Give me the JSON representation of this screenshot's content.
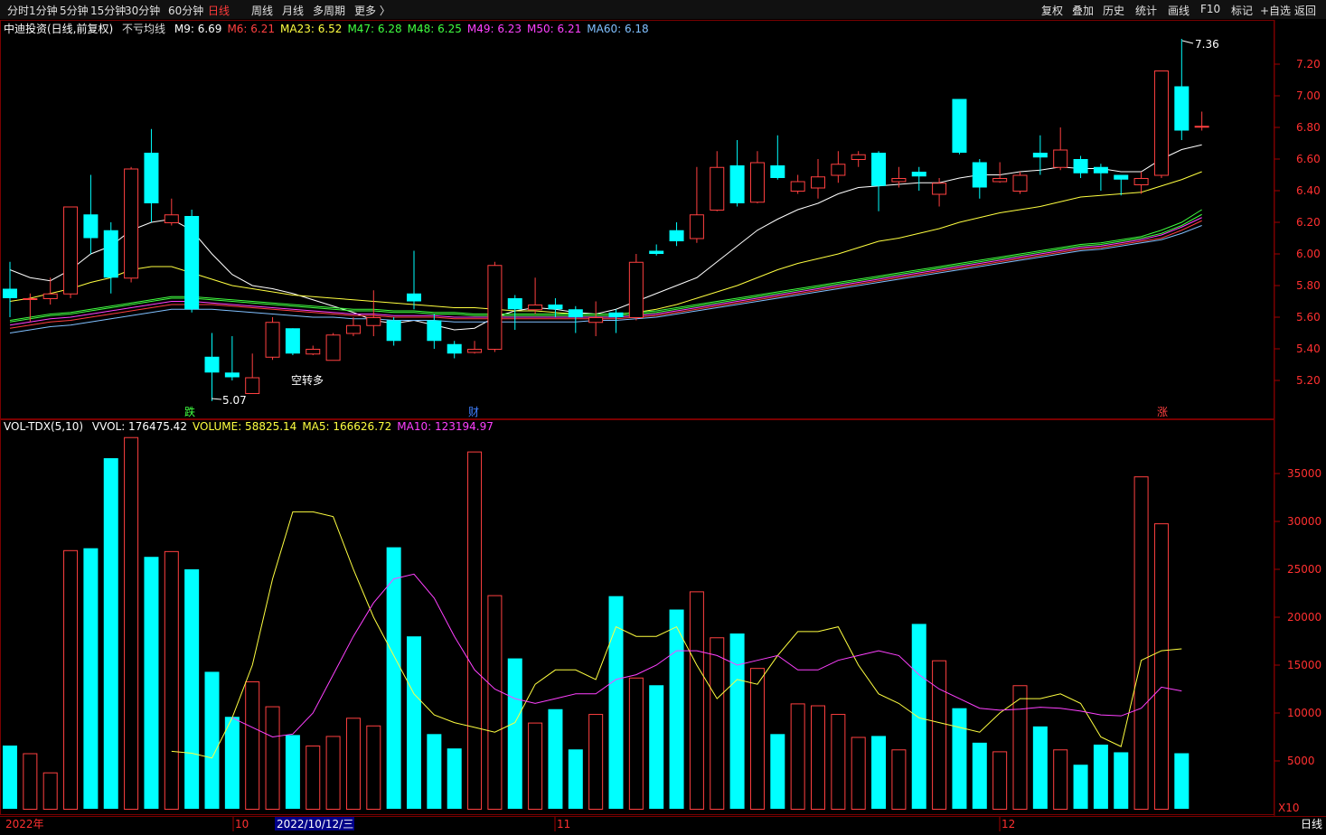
{
  "toolbar": {
    "periods": [
      "分时",
      "1分钟",
      "5分钟",
      "15分钟",
      "30分钟",
      "60分钟",
      "日线",
      "周线",
      "月线",
      "多周期",
      "更多 〉"
    ],
    "active_period": "日线",
    "right_items": [
      "复权",
      "叠加",
      "历史",
      "统计",
      "画线",
      "F10",
      "标记",
      "+自选",
      "返回"
    ]
  },
  "candle_legend": {
    "stock": "中迪投资(日线,前复权)",
    "indicator": "不亏均线",
    "items": [
      {
        "label": "M9: 6.69",
        "color": "#ffffff"
      },
      {
        "label": "M6: 6.21",
        "color": "#ff4040"
      },
      {
        "label": "MA23: 6.52",
        "color": "#ffff40"
      },
      {
        "label": "M47: 6.28",
        "color": "#40ff40"
      },
      {
        "label": "M48: 6.25",
        "color": "#40ff40"
      },
      {
        "label": "M49: 6.23",
        "color": "#ff40ff"
      },
      {
        "label": "M50: 6.21",
        "color": "#ff40ff"
      },
      {
        "label": "MA60: 6.18",
        "color": "#80c0ff"
      }
    ]
  },
  "vol_legend": {
    "name": "VOL-TDX(5,10)",
    "items": [
      {
        "label": "VVOL: 176475.42",
        "color": "#ffffff"
      },
      {
        "label": "VOLUME: 58825.14",
        "color": "#ffff40"
      },
      {
        "label": "MA5: 166626.72",
        "color": "#ffff40"
      },
      {
        "label": "MA10: 123194.97",
        "color": "#ff40ff"
      }
    ]
  },
  "price_axis": [
    "7.20",
    "7.00",
    "6.80",
    "6.60",
    "6.40",
    "6.20",
    "6.00",
    "5.80",
    "5.60",
    "5.40",
    "5.20"
  ],
  "vol_axis": [
    "35000",
    "30000",
    "25000",
    "20000",
    "15000",
    "10000",
    "5000"
  ],
  "annotations": {
    "high": "7.36",
    "low": "5.07",
    "signal": "空转多",
    "marker_down": "跌",
    "marker_fin": "财",
    "marker_up": "涨",
    "vol_unit": "X10"
  },
  "date_axis": {
    "year": "2022年",
    "months": [
      "10",
      "11",
      "12"
    ],
    "cursor_date": "2022/10/12/三"
  },
  "bottom_tab": "日线",
  "colors": {
    "up": "#ff4040",
    "down": "#00ffff",
    "bg": "#000000"
  },
  "chart_data": {
    "type": "candlestick",
    "candles": [
      {
        "o": 5.78,
        "c": 5.72,
        "h": 5.95,
        "l": 5.6
      },
      {
        "o": 5.72,
        "c": 5.72,
        "h": 5.75,
        "l": 5.57
      },
      {
        "o": 5.72,
        "c": 5.75,
        "h": 5.85,
        "l": 5.68
      },
      {
        "o": 5.75,
        "c": 6.3,
        "h": 6.3,
        "l": 5.72
      },
      {
        "o": 6.25,
        "c": 6.1,
        "h": 6.5,
        "l": 6.0
      },
      {
        "o": 6.15,
        "c": 5.85,
        "h": 6.2,
        "l": 5.75
      },
      {
        "o": 5.85,
        "c": 6.54,
        "h": 6.55,
        "l": 5.82
      },
      {
        "o": 6.64,
        "c": 6.32,
        "h": 6.79,
        "l": 6.2
      },
      {
        "o": 6.2,
        "c": 6.25,
        "h": 6.35,
        "l": 6.18
      },
      {
        "o": 6.24,
        "c": 5.65,
        "h": 6.28,
        "l": 5.63
      },
      {
        "o": 5.35,
        "c": 5.25,
        "h": 5.5,
        "l": 5.07
      },
      {
        "o": 5.25,
        "c": 5.22,
        "h": 5.48,
        "l": 5.2
      },
      {
        "o": 5.12,
        "c": 5.22,
        "h": 5.37,
        "l": 5.12
      },
      {
        "o": 5.35,
        "c": 5.57,
        "h": 5.6,
        "l": 5.33
      },
      {
        "o": 5.53,
        "c": 5.37,
        "h": 5.53,
        "l": 5.36
      },
      {
        "o": 5.37,
        "c": 5.4,
        "h": 5.42,
        "l": 5.36
      },
      {
        "o": 5.33,
        "c": 5.49,
        "h": 5.5,
        "l": 5.33
      },
      {
        "o": 5.5,
        "c": 5.55,
        "h": 5.6,
        "l": 5.48
      },
      {
        "o": 5.55,
        "c": 5.6,
        "h": 5.77,
        "l": 5.48
      },
      {
        "o": 5.58,
        "c": 5.45,
        "h": 5.6,
        "l": 5.42
      },
      {
        "o": 5.75,
        "c": 5.7,
        "h": 6.02,
        "l": 5.65
      },
      {
        "o": 5.58,
        "c": 5.45,
        "h": 5.62,
        "l": 5.4
      },
      {
        "o": 5.43,
        "c": 5.37,
        "h": 5.45,
        "l": 5.34
      },
      {
        "o": 5.38,
        "c": 5.4,
        "h": 5.45,
        "l": 5.37
      },
      {
        "o": 5.4,
        "c": 5.93,
        "h": 5.95,
        "l": 5.38
      },
      {
        "o": 5.72,
        "c": 5.65,
        "h": 5.74,
        "l": 5.52
      },
      {
        "o": 5.65,
        "c": 5.68,
        "h": 5.85,
        "l": 5.62
      },
      {
        "o": 5.68,
        "c": 5.65,
        "h": 5.72,
        "l": 5.6
      },
      {
        "o": 5.65,
        "c": 5.6,
        "h": 5.67,
        "l": 5.5
      },
      {
        "o": 5.57,
        "c": 5.6,
        "h": 5.7,
        "l": 5.48
      },
      {
        "o": 5.63,
        "c": 5.6,
        "h": 5.65,
        "l": 5.5
      },
      {
        "o": 5.6,
        "c": 5.95,
        "h": 6.0,
        "l": 5.58
      },
      {
        "o": 6.02,
        "c": 6.0,
        "h": 6.06,
        "l": 5.99
      },
      {
        "o": 6.15,
        "c": 6.08,
        "h": 6.2,
        "l": 6.05
      },
      {
        "o": 6.1,
        "c": 6.25,
        "h": 6.55,
        "l": 6.07
      },
      {
        "o": 6.28,
        "c": 6.55,
        "h": 6.65,
        "l": 6.27
      },
      {
        "o": 6.56,
        "c": 6.32,
        "h": 6.72,
        "l": 6.3
      },
      {
        "o": 6.33,
        "c": 6.58,
        "h": 6.65,
        "l": 6.32
      },
      {
        "o": 6.56,
        "c": 6.48,
        "h": 6.75,
        "l": 6.47
      },
      {
        "o": 6.4,
        "c": 6.46,
        "h": 6.5,
        "l": 6.38
      },
      {
        "o": 6.42,
        "c": 6.49,
        "h": 6.6,
        "l": 6.35
      },
      {
        "o": 6.5,
        "c": 6.57,
        "h": 6.65,
        "l": 6.45
      },
      {
        "o": 6.6,
        "c": 6.63,
        "h": 6.65,
        "l": 6.55
      },
      {
        "o": 6.64,
        "c": 6.43,
        "h": 6.65,
        "l": 6.27
      },
      {
        "o": 6.46,
        "c": 6.48,
        "h": 6.55,
        "l": 6.42
      },
      {
        "o": 6.52,
        "c": 6.49,
        "h": 6.55,
        "l": 6.4
      },
      {
        "o": 6.38,
        "c": 6.45,
        "h": 6.48,
        "l": 6.3
      },
      {
        "o": 6.98,
        "c": 6.64,
        "h": 6.98,
        "l": 6.63
      },
      {
        "o": 6.58,
        "c": 6.42,
        "h": 6.6,
        "l": 6.35
      },
      {
        "o": 6.46,
        "c": 6.48,
        "h": 6.58,
        "l": 6.45
      },
      {
        "o": 6.4,
        "c": 6.5,
        "h": 6.52,
        "l": 6.38
      },
      {
        "o": 6.64,
        "c": 6.61,
        "h": 6.75,
        "l": 6.5
      },
      {
        "o": 6.55,
        "c": 6.66,
        "h": 6.8,
        "l": 6.53
      },
      {
        "o": 6.6,
        "c": 6.51,
        "h": 6.62,
        "l": 6.48
      },
      {
        "o": 6.55,
        "c": 6.51,
        "h": 6.57,
        "l": 6.4
      },
      {
        "o": 6.5,
        "c": 6.47,
        "h": 6.5,
        "l": 6.37
      },
      {
        "o": 6.44,
        "c": 6.48,
        "h": 6.52,
        "l": 6.38
      },
      {
        "o": 6.5,
        "c": 7.16,
        "h": 7.16,
        "l": 6.48
      },
      {
        "o": 7.06,
        "c": 6.78,
        "h": 7.36,
        "l": 6.72
      },
      {
        "o": 6.81,
        "c": 6.81,
        "h": 6.9,
        "l": 6.78
      }
    ],
    "volumes": [
      6600,
      5800,
      3800,
      27000,
      27200,
      36600,
      38800,
      26300,
      26900,
      25000,
      14300,
      9600,
      13300,
      10700,
      7700,
      6600,
      7600,
      9500,
      8700,
      27300,
      18000,
      7800,
      6300,
      37300,
      22300,
      15700,
      9000,
      10400,
      6200,
      9900,
      22200,
      13700,
      12900,
      20800,
      22700,
      17900,
      18300,
      14700,
      7800,
      11000,
      10800,
      9900,
      7500,
      7600,
      6200,
      19300,
      15500,
      10500,
      6900,
      6000,
      12900,
      8600,
      6200,
      4600,
      6700,
      5900,
      34700,
      29800,
      5800
    ],
    "ma_lines": [
      {
        "name": "M9",
        "color": "#ffffff",
        "values": [
          5.9,
          5.85,
          5.83,
          5.9,
          6.0,
          6.05,
          6.15,
          6.2,
          6.22,
          6.15,
          6.0,
          5.87,
          5.8,
          5.78,
          5.75,
          5.71,
          5.67,
          5.63,
          5.58,
          5.56,
          5.58,
          5.55,
          5.52,
          5.53,
          5.6,
          5.64,
          5.66,
          5.65,
          5.63,
          5.62,
          5.65,
          5.7,
          5.75,
          5.8,
          5.85,
          5.95,
          6.05,
          6.15,
          6.22,
          6.28,
          6.32,
          6.38,
          6.42,
          6.43,
          6.44,
          6.45,
          6.45,
          6.48,
          6.5,
          6.5,
          6.52,
          6.53,
          6.55,
          6.54,
          6.54,
          6.52,
          6.52,
          6.6,
          6.66,
          6.69
        ]
      },
      {
        "name": "MA23",
        "color": "#ffff40",
        "values": [
          5.7,
          5.72,
          5.75,
          5.78,
          5.82,
          5.85,
          5.9,
          5.92,
          5.92,
          5.88,
          5.84,
          5.8,
          5.78,
          5.76,
          5.74,
          5.73,
          5.72,
          5.71,
          5.7,
          5.69,
          5.68,
          5.67,
          5.66,
          5.66,
          5.65,
          5.64,
          5.64,
          5.63,
          5.62,
          5.62,
          5.62,
          5.63,
          5.65,
          5.68,
          5.72,
          5.76,
          5.8,
          5.85,
          5.9,
          5.94,
          5.97,
          6.0,
          6.04,
          6.08,
          6.1,
          6.13,
          6.16,
          6.2,
          6.23,
          6.26,
          6.28,
          6.3,
          6.33,
          6.36,
          6.37,
          6.38,
          6.39,
          6.43,
          6.47,
          6.52
        ]
      },
      {
        "name": "M47",
        "color": "#40ff40",
        "values": [
          5.58,
          5.6,
          5.62,
          5.63,
          5.65,
          5.67,
          5.69,
          5.71,
          5.73,
          5.73,
          5.72,
          5.71,
          5.7,
          5.69,
          5.68,
          5.67,
          5.66,
          5.65,
          5.65,
          5.64,
          5.64,
          5.63,
          5.63,
          5.62,
          5.62,
          5.62,
          5.62,
          5.62,
          5.62,
          5.62,
          5.62,
          5.63,
          5.64,
          5.66,
          5.68,
          5.7,
          5.72,
          5.74,
          5.76,
          5.78,
          5.8,
          5.82,
          5.84,
          5.86,
          5.88,
          5.9,
          5.92,
          5.94,
          5.96,
          5.98,
          6.0,
          6.02,
          6.04,
          6.06,
          6.07,
          6.09,
          6.11,
          6.15,
          6.2,
          6.28
        ]
      },
      {
        "name": "M48",
        "color": "#40ff40",
        "values": [
          5.57,
          5.59,
          5.61,
          5.62,
          5.64,
          5.66,
          5.68,
          5.7,
          5.72,
          5.72,
          5.71,
          5.7,
          5.69,
          5.68,
          5.67,
          5.66,
          5.65,
          5.64,
          5.64,
          5.63,
          5.63,
          5.62,
          5.62,
          5.61,
          5.61,
          5.61,
          5.61,
          5.61,
          5.61,
          5.61,
          5.61,
          5.62,
          5.63,
          5.65,
          5.67,
          5.69,
          5.71,
          5.73,
          5.75,
          5.77,
          5.79,
          5.81,
          5.83,
          5.85,
          5.87,
          5.89,
          5.91,
          5.93,
          5.95,
          5.97,
          5.99,
          6.01,
          6.03,
          6.05,
          6.06,
          6.08,
          6.1,
          6.13,
          6.18,
          6.25
        ]
      },
      {
        "name": "M49",
        "color": "#ff40ff",
        "values": [
          5.55,
          5.57,
          5.59,
          5.6,
          5.62,
          5.64,
          5.66,
          5.68,
          5.7,
          5.7,
          5.69,
          5.68,
          5.67,
          5.66,
          5.65,
          5.64,
          5.63,
          5.62,
          5.62,
          5.61,
          5.61,
          5.61,
          5.6,
          5.6,
          5.6,
          5.6,
          5.6,
          5.6,
          5.6,
          5.6,
          5.6,
          5.61,
          5.62,
          5.64,
          5.66,
          5.68,
          5.7,
          5.72,
          5.74,
          5.76,
          5.78,
          5.8,
          5.82,
          5.84,
          5.86,
          5.88,
          5.9,
          5.92,
          5.94,
          5.96,
          5.98,
          6.0,
          6.02,
          6.04,
          6.05,
          6.07,
          6.09,
          6.12,
          6.17,
          6.23
        ]
      },
      {
        "name": "M50",
        "color": "#ff4040",
        "values": [
          5.53,
          5.55,
          5.57,
          5.58,
          5.6,
          5.62,
          5.64,
          5.66,
          5.68,
          5.68,
          5.68,
          5.67,
          5.66,
          5.65,
          5.64,
          5.63,
          5.62,
          5.61,
          5.61,
          5.6,
          5.6,
          5.6,
          5.59,
          5.59,
          5.59,
          5.59,
          5.59,
          5.59,
          5.59,
          5.59,
          5.59,
          5.6,
          5.61,
          5.63,
          5.65,
          5.67,
          5.69,
          5.71,
          5.73,
          5.75,
          5.77,
          5.79,
          5.81,
          5.83,
          5.85,
          5.87,
          5.89,
          5.91,
          5.93,
          5.95,
          5.97,
          5.99,
          6.01,
          6.03,
          6.04,
          6.06,
          6.08,
          6.1,
          6.15,
          6.21
        ]
      },
      {
        "name": "MA60",
        "color": "#80c0ff",
        "values": [
          5.5,
          5.52,
          5.54,
          5.55,
          5.57,
          5.59,
          5.61,
          5.63,
          5.65,
          5.65,
          5.65,
          5.64,
          5.63,
          5.62,
          5.61,
          5.6,
          5.6,
          5.59,
          5.59,
          5.58,
          5.58,
          5.58,
          5.57,
          5.57,
          5.57,
          5.57,
          5.57,
          5.57,
          5.57,
          5.58,
          5.58,
          5.59,
          5.6,
          5.62,
          5.64,
          5.66,
          5.68,
          5.7,
          5.72,
          5.74,
          5.76,
          5.78,
          5.8,
          5.82,
          5.84,
          5.86,
          5.88,
          5.9,
          5.92,
          5.94,
          5.96,
          5.98,
          6.0,
          6.02,
          6.03,
          6.05,
          6.07,
          6.09,
          6.13,
          6.18
        ]
      }
    ],
    "vol_ma5": [
      6000,
      5800,
      5300,
      9500,
      15000,
      24000,
      31000,
      31000,
      30500,
      25000,
      20000,
      16000,
      12000,
      9800,
      9000,
      8500,
      8000,
      9000,
      13000,
      14500,
      14500,
      13500,
      19000,
      18000,
      18000,
      19000,
      15000,
      11500,
      13500,
      13000,
      16000,
      18500,
      18500,
      19000,
      15000,
      12000,
      11000,
      9500,
      9000,
      8500,
      8000,
      10000,
      11500,
      11500,
      12000,
      11000,
      7500,
      6500,
      15500,
      16500,
      16700
    ],
    "vol_ma10": [
      9500,
      8500,
      7500,
      7800,
      10000,
      14000,
      18000,
      21500,
      24000,
      24500,
      22000,
      18000,
      14500,
      12500,
      11500,
      11000,
      11500,
      12000,
      12000,
      13500,
      14000,
      15000,
      16500,
      16500,
      16000,
      15000,
      15500,
      16000,
      14500,
      14500,
      15500,
      16000,
      16500,
      16000,
      14000,
      12500,
      11500,
      10500,
      10300,
      10400,
      10600,
      10500,
      10200,
      9800,
      9700,
      10500,
      12700,
      12300
    ]
  }
}
